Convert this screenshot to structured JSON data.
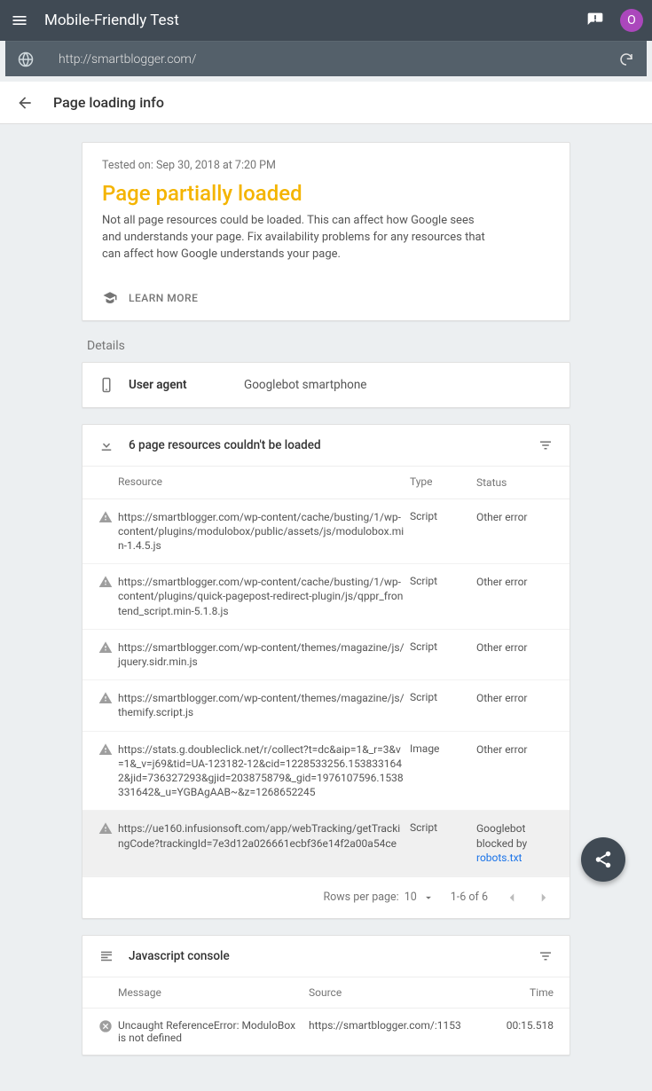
{
  "appbar": {
    "title": "Mobile-Friendly Test",
    "avatar_letter": "O"
  },
  "urlbar": {
    "url": "http://smartblogger.com/"
  },
  "subheader": {
    "title": "Page loading info"
  },
  "summary": {
    "tested_on": "Tested on: Sep 30, 2018 at 7:20 PM",
    "heading": "Page partially loaded",
    "description": "Not all page resources could be loaded. This can affect how Google sees and understands your page. Fix availability problems for any resources that can affect how Google understands your page.",
    "learn_more": "LEARN MORE"
  },
  "details": {
    "label": "Details",
    "user_agent_label": "User agent",
    "user_agent_value": "Googlebot smartphone"
  },
  "resources": {
    "header": "6 page resources couldn't be loaded",
    "columns": {
      "resource": "Resource",
      "type": "Type",
      "status": "Status"
    },
    "rows": [
      {
        "url": "https://smartblogger.com/wp-content/cache/busting/1/wp-content/plugins/modulobox/public/assets/js/modulobox.min-1.4.5.js",
        "type": "Script",
        "status": "Other error",
        "selected": false
      },
      {
        "url": "https://smartblogger.com/wp-content/cache/busting/1/wp-content/plugins/quick-pagepost-redirect-plugin/js/qppr_frontend_script.min-5.1.8.js",
        "type": "Script",
        "status": "Other error",
        "selected": false
      },
      {
        "url": "https://smartblogger.com/wp-content/themes/magazine/js/jquery.sidr.min.js",
        "type": "Script",
        "status": "Other error",
        "selected": false
      },
      {
        "url": "https://smartblogger.com/wp-content/themes/magazine/js/themify.script.js",
        "type": "Script",
        "status": "Other error",
        "selected": false
      },
      {
        "url": "https://stats.g.doubleclick.net/r/collect?t=dc&aip=1&_r=3&v=1&_v=j69&tid=UA-123182-12&cid=1228533256.1538331642&jid=736327293&gjid=203875879&_gid=1976107596.1538331642&_u=YGBAgAAB~&z=1268652245",
        "type": "Image",
        "status": "Other error",
        "selected": false
      },
      {
        "url": "https://ue160.infusionsoft.com/app/webTracking/getTrackingCode?trackingId=7e3d12a026661ecbf36e14f2a00a54ce",
        "type": "Script",
        "status_prefix": "Googlebot blocked by ",
        "status_link": "robots.txt",
        "selected": true
      }
    ],
    "pagination": {
      "rows_per_page_label": "Rows per page:",
      "rows_per_page_value": "10",
      "range": "1-6 of 6"
    }
  },
  "console": {
    "header": "Javascript console",
    "columns": {
      "message": "Message",
      "source": "Source",
      "time": "Time"
    },
    "rows": [
      {
        "message": "Uncaught ReferenceError: ModuloBox is not defined",
        "source": "https://smartblogger.com/:1153",
        "time": "00:15.518"
      }
    ]
  }
}
